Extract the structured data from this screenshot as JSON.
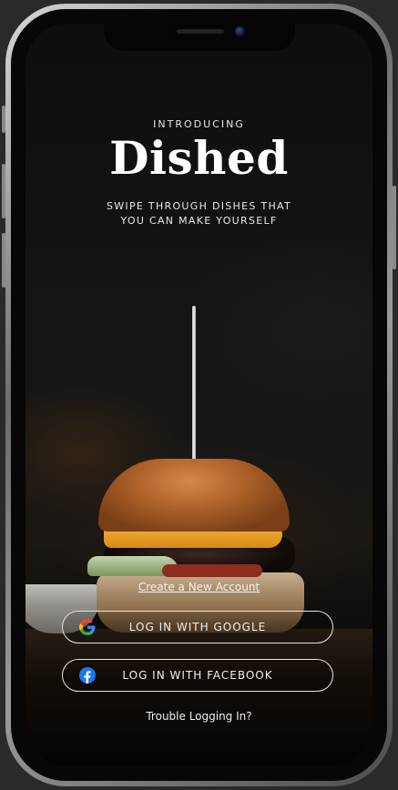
{
  "header": {
    "eyebrow": "INTRODUCING",
    "app_name": "Dished",
    "tagline": "SWIPE THROUGH DISHES THAT YOU CAN MAKE YOURSELF"
  },
  "actions": {
    "create_account_label": "Create a New Account",
    "google_label": "LOG IN WITH GOOGLE",
    "facebook_label": "LOG IN WITH FACEBOOK",
    "trouble_label": "Trouble Logging In?"
  },
  "icons": {
    "google": "google-logo-icon",
    "facebook": "facebook-logo-icon"
  },
  "colors": {
    "background": "#0e0e0e",
    "text": "#ffffff",
    "button_border": "#e5e5e5",
    "facebook_blue": "#1877f2"
  }
}
